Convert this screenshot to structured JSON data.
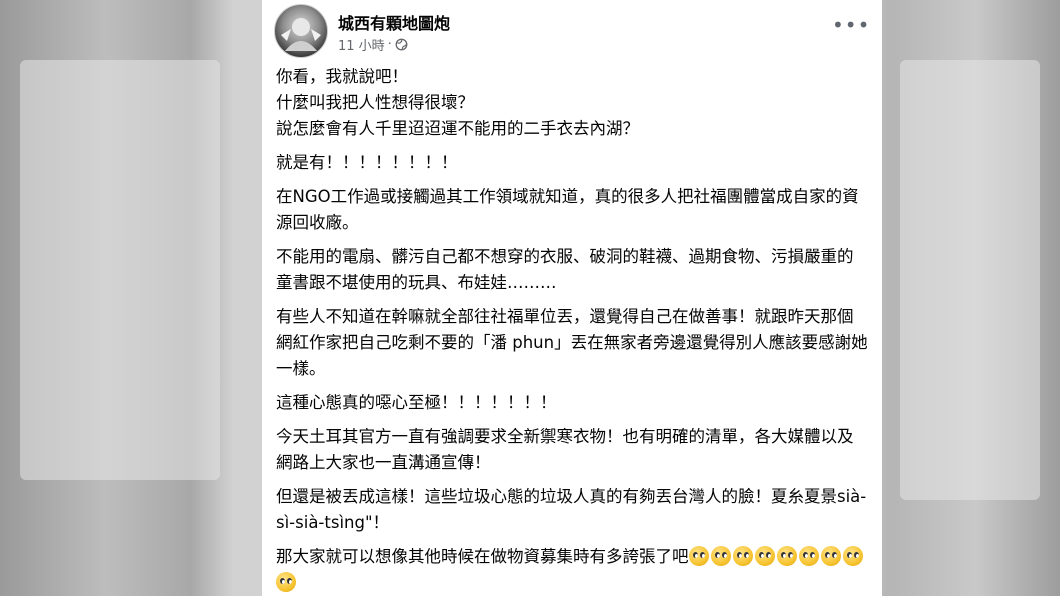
{
  "post": {
    "author": "城西有顆地圖炮",
    "time": "11 小時",
    "separator": "·",
    "more_label": "•••",
    "paragraphs": [
      "你看，我就說吧！\n什麼叫我把人性想得很壞？\n說怎麼會有人千里迢迢運不能用的二手衣去內湖？",
      "就是有！！！！！！！！",
      "在NGO工作過或接觸過其工作領域就知道，真的很多人把社福團體當成自家的資源回收廠。",
      "不能用的電扇、髒污自己都不想穿的衣服、破洞的鞋襪、過期食物、污損嚴重的童書跟不堪使用的玩具、布娃娃………",
      "有些人不知道在幹嘛就全部往社福單位丟，還覺得自己在做善事！就跟昨天那個網紅作家把自己吃剩不要的「潘 phun」丟在無家者旁邊還覺得別人應該要感謝她一樣。",
      "這種心態真的噁心至極！！！！！！！",
      "今天土耳其官方一直有強調要求全新禦寒衣物！也有明確的清單，各大媒體以及網路上大家也一直溝通宣傳！",
      "但還是被丟成這樣！這些垃圾心態的垃圾人真的有夠丟台灣人的臉！夏糸夏景sià-sì-sià-tsìng\"！"
    ],
    "last_paragraph_text": "那大家就可以想像其他時候在做物資募集時有多誇張了吧",
    "emoji_name": "rolling-eyes-icon"
  }
}
